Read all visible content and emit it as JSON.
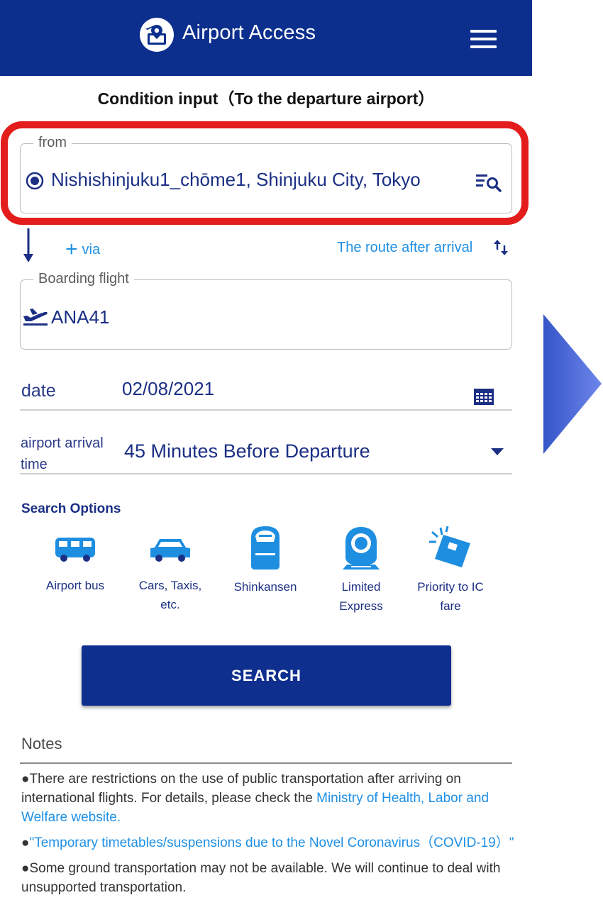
{
  "header": {
    "app_title": "Airport Access"
  },
  "page_title": "Condition input（To the departure airport）",
  "from": {
    "legend": "from",
    "value": "Nishishinjuku1_chōme1, Shinjuku City, Tokyo"
  },
  "via_label": "via",
  "route_after_label": "The route after arrival",
  "boarding": {
    "legend": "Boarding flight",
    "value": "ANA41"
  },
  "date": {
    "label": "date",
    "value": "02/08/2021"
  },
  "arrival": {
    "label": "airport arrival time",
    "value": "45 Minutes Before Departure"
  },
  "search_options": {
    "title": "Search Options",
    "items": [
      {
        "label": "Airport bus",
        "icon": "bus-icon"
      },
      {
        "label": "Cars, Taxis, etc.",
        "icon": "car-icon"
      },
      {
        "label": "Shinkansen",
        "icon": "shinkansen-icon"
      },
      {
        "label": "Limited Express",
        "icon": "limited-express-icon"
      },
      {
        "label": "Priority to IC fare",
        "icon": "ic-card-icon"
      }
    ]
  },
  "search_button": "SEARCH",
  "notes": {
    "title": "Notes",
    "items": [
      {
        "bullet": "●",
        "text": "There are restrictions on the use of public transportation after arriving on international flights. For details, please check the ",
        "link": "Ministry of Health, Labor and Welfare website."
      },
      {
        "bullet": "●",
        "text": "",
        "link": "\"Temporary timetables/suspensions due to the Novel Coronavirus（COVID-19）\""
      },
      {
        "bullet": "●",
        "text": "Some ground transportation may not be available. We will continue to deal with unsupported transportation.",
        "link": ""
      }
    ]
  },
  "colors": {
    "header": "#0c2f8d",
    "primary_text": "#1b2f84",
    "link": "#1e90e6",
    "highlight": "#e31c1c"
  }
}
